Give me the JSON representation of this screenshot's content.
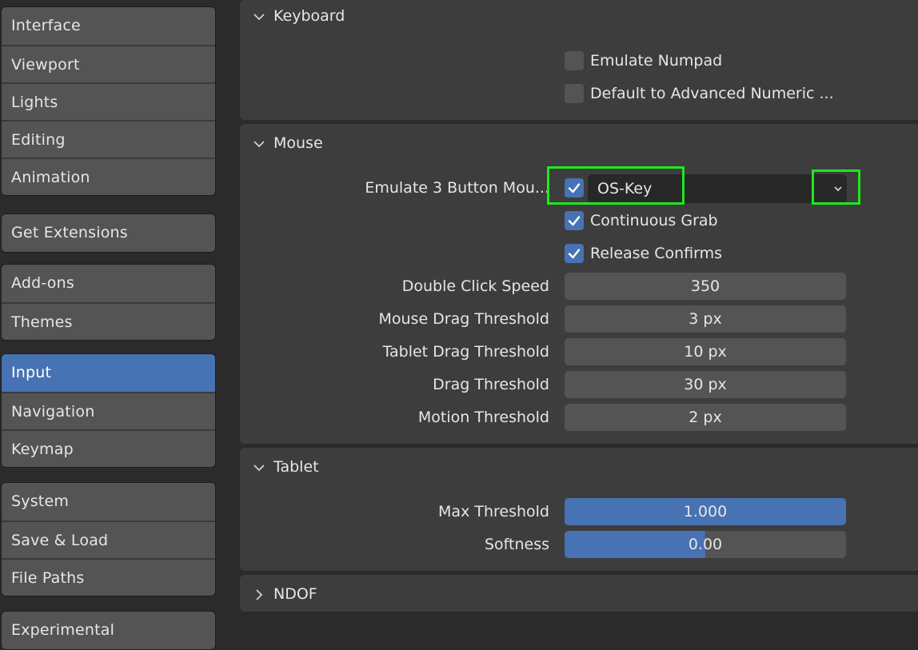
{
  "sidebar": {
    "groups": [
      [
        "Interface",
        "Viewport",
        "Lights",
        "Editing",
        "Animation"
      ],
      [
        "Get Extensions"
      ],
      [
        "Add-ons",
        "Themes"
      ],
      [
        "Input",
        "Navigation",
        "Keymap"
      ],
      [
        "System",
        "Save & Load",
        "File Paths"
      ],
      [
        "Experimental"
      ]
    ],
    "active": "Input"
  },
  "keyboard": {
    "title": "Keyboard",
    "emulate_numpad": {
      "label": "Emulate Numpad",
      "checked": false
    },
    "default_adv_numeric": {
      "label": "Default to Advanced Numeric ...",
      "checked": false
    }
  },
  "mouse": {
    "title": "Mouse",
    "emulate_3_button": {
      "label": "Emulate 3 Button Mou...",
      "checked": true,
      "value": "OS-Key"
    },
    "continuous_grab": {
      "label": "Continuous Grab",
      "checked": true
    },
    "release_confirms": {
      "label": "Release Confirms",
      "checked": true
    },
    "fields": [
      {
        "label": "Double Click Speed",
        "value": "350"
      },
      {
        "label": "Mouse Drag Threshold",
        "value": "3 px"
      },
      {
        "label": "Tablet Drag Threshold",
        "value": "10 px"
      },
      {
        "label": "Drag Threshold",
        "value": "30 px"
      },
      {
        "label": "Motion Threshold",
        "value": "2 px"
      }
    ]
  },
  "tablet": {
    "title": "Tablet",
    "max_threshold": {
      "label": "Max Threshold",
      "value": "1.000",
      "fraction": 1.0
    },
    "softness": {
      "label": "Softness",
      "value": "0.00",
      "fraction": 0.5
    }
  },
  "ndof": {
    "title": "NDOF"
  },
  "colors": {
    "accent": "#4772b3",
    "highlight": "#1de91d",
    "panel": "#3d3d3d",
    "widget": "#545454"
  },
  "icons": {
    "expanded": "chevron-down-icon",
    "collapsed": "chevron-right-icon",
    "check": "checkmark-icon",
    "dropdown": "chevron-down-icon"
  }
}
